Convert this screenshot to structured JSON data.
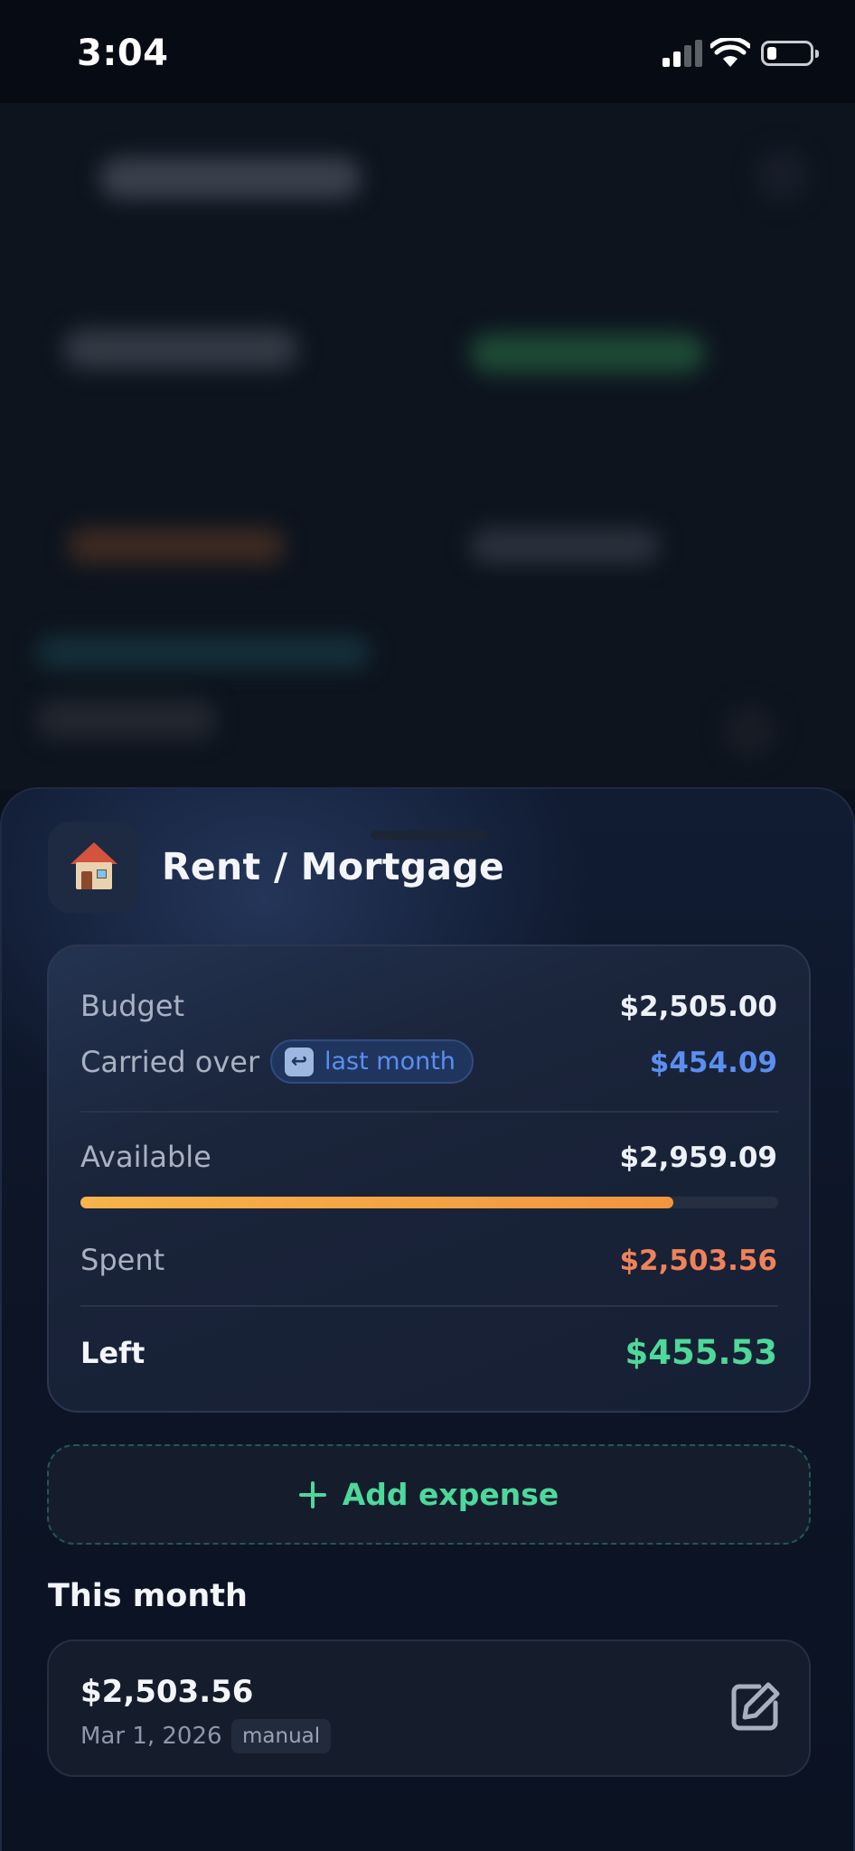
{
  "status_bar": {
    "time": "3:04"
  },
  "sheet": {
    "title": "Rent / Mortgage",
    "category_icon": "house-icon",
    "summary": {
      "budget_label": "Budget",
      "budget_value": "$2,505.00",
      "carried_label": "Carried over",
      "carried_badge": "last month",
      "carried_badge_icon": "return-arrow-icon",
      "carried_value": "$454.09",
      "available_label": "Available",
      "available_value": "$2,959.09",
      "spent_fraction": 0.85,
      "spent_label": "Spent",
      "spent_value": "$2,503.56",
      "left_label": "Left",
      "left_value": "$455.53"
    },
    "add_expense_label": "Add expense",
    "section_title": "This month",
    "expenses": [
      {
        "amount": "$2,503.56",
        "date": "Mar 1, 2026",
        "tag": "manual"
      }
    ]
  },
  "colors": {
    "accent_green": "#4ed89a",
    "accent_blue": "#5b8ef2",
    "accent_orange": "#f0825a",
    "progress_fill": "#f6a444"
  }
}
